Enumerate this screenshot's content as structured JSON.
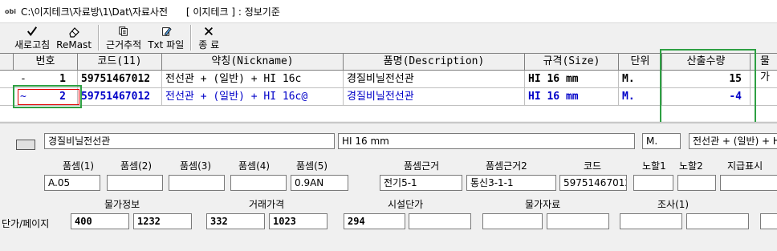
{
  "window": {
    "app_icon_text": "obi",
    "title": "C:\\이지테크\\자료방\\1\\Dat\\자료사전      [ 이지테크 ] : 정보기준"
  },
  "toolbar": {
    "new_query": "새로고침",
    "remast": "ReMast",
    "basis_trace": "근거추적",
    "txt_file": "Txt 파일",
    "exit": "종  료"
  },
  "grid": {
    "headers": [
      "번호",
      "코드(11)",
      "약칭(Nickname)",
      "품명(Description)",
      "규격(Size)",
      "단위",
      "산출수량",
      "물가"
    ],
    "rows": [
      {
        "mark": "-",
        "num": "1",
        "code": "59751467012",
        "nick": "전선관 + (일반) + HI 16c",
        "desc": "경질비닐전선관",
        "size": "HI 16 mm",
        "unit": "M.",
        "qty": "15"
      },
      {
        "mark": "~",
        "num": "2",
        "code": "59751467012",
        "nick": "전선관 + (일반) + HI 16c@",
        "desc": "경질비닐전선관",
        "size": "HI 16 mm",
        "unit": "M.",
        "qty": "-4"
      }
    ]
  },
  "detail": {
    "desc_value": "경질비닐전선관",
    "size_value": "HI 16 mm",
    "unit_value": "M.",
    "nick_value": "전선관 + (일반) + H",
    "labels": {
      "p1": "품셈(1)",
      "p2": "품셈(2)",
      "p3": "품셈(3)",
      "p4": "품셈(4)",
      "p5": "품셈(5)",
      "basis": "품셈근거",
      "basis2": "품셈근거2",
      "code": "코드",
      "labor1": "노할1",
      "labor2": "노할2",
      "pay": "지급표시",
      "price_info": "물가정보",
      "trade_price": "거래가격",
      "facility_price": "시설단가",
      "price_data": "물가자료",
      "survey": "조사(1)",
      "unit_page": "단가/페이지"
    },
    "values": {
      "p1": "A.05",
      "p5": "0.9AN",
      "basis": "전기5-1",
      "basis2": "통신3-1-1",
      "code": "59751467012",
      "price_info": "400",
      "price_page": "1232",
      "trade_price": "332",
      "trade_page": "1023",
      "facility_price": "294"
    }
  }
}
